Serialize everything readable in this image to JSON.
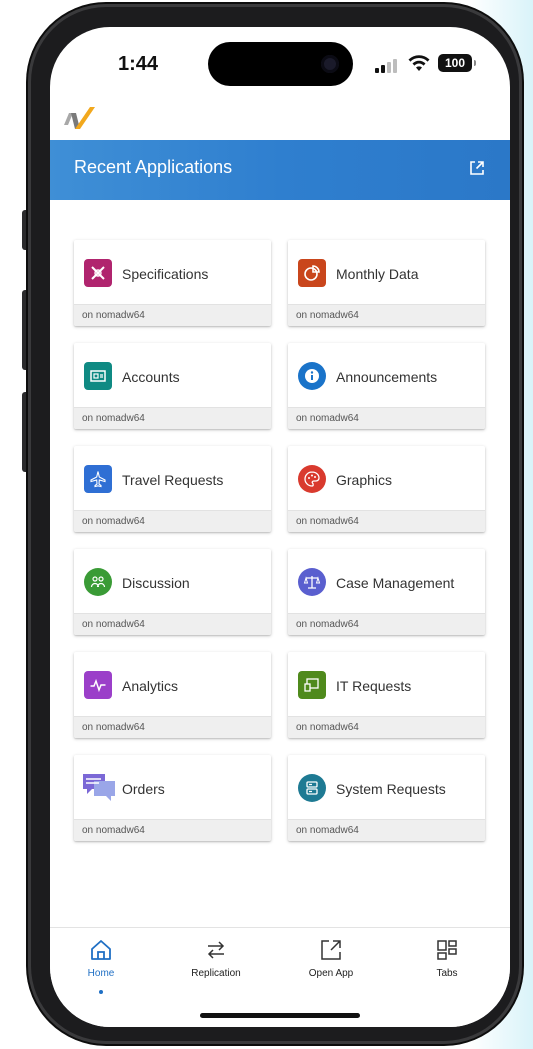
{
  "status": {
    "time": "1:44",
    "battery": "100"
  },
  "header": {
    "title": "Recent Applications"
  },
  "apps": [
    {
      "title": "Specifications",
      "server": "on nomadw64",
      "icon": "specifications-icon",
      "color": "#b0246e"
    },
    {
      "title": "Monthly Data",
      "server": "on nomadw64",
      "icon": "pie-chart-icon",
      "color": "#c9461c"
    },
    {
      "title": "Accounts",
      "server": "on nomadw64",
      "icon": "accounts-icon",
      "color": "#0f8a83"
    },
    {
      "title": "Announcements",
      "server": "on nomadw64",
      "icon": "info-icon",
      "color": "#1a73c9"
    },
    {
      "title": "Travel Requests",
      "server": "on nomadw64",
      "icon": "airplane-icon",
      "color": "#2f6fd4"
    },
    {
      "title": "Graphics",
      "server": "on nomadw64",
      "icon": "palette-icon",
      "color": "#d93a2e"
    },
    {
      "title": "Discussion",
      "server": "on nomadw64",
      "icon": "people-icon",
      "color": "#3a9b36"
    },
    {
      "title": "Case Management",
      "server": "on nomadw64",
      "icon": "scales-icon",
      "color": "#5a5fcf"
    },
    {
      "title": "Analytics",
      "server": "on nomadw64",
      "icon": "pulse-icon",
      "color": "#9b3fc9"
    },
    {
      "title": "IT Requests",
      "server": "on nomadw64",
      "icon": "monitor-icon",
      "color": "#4f8a1c"
    },
    {
      "title": "Orders",
      "server": "on nomadw64",
      "icon": "chat-bubbles-icon",
      "color": "#6a5acd"
    },
    {
      "title": "System Requests",
      "server": "on nomadw64",
      "icon": "server-icon",
      "color": "#1e7a93"
    }
  ],
  "tabs": [
    {
      "label": "Home",
      "icon": "home-icon",
      "active": true
    },
    {
      "label": "Replication",
      "icon": "replication-icon",
      "active": false
    },
    {
      "label": "Open App",
      "icon": "open-app-icon",
      "active": false
    },
    {
      "label": "Tabs",
      "icon": "tabs-icon",
      "active": false
    }
  ],
  "colors": {
    "header_start": "#3f8fd6",
    "header_end": "#2b78c8",
    "active_tab": "#1f6fc4"
  }
}
